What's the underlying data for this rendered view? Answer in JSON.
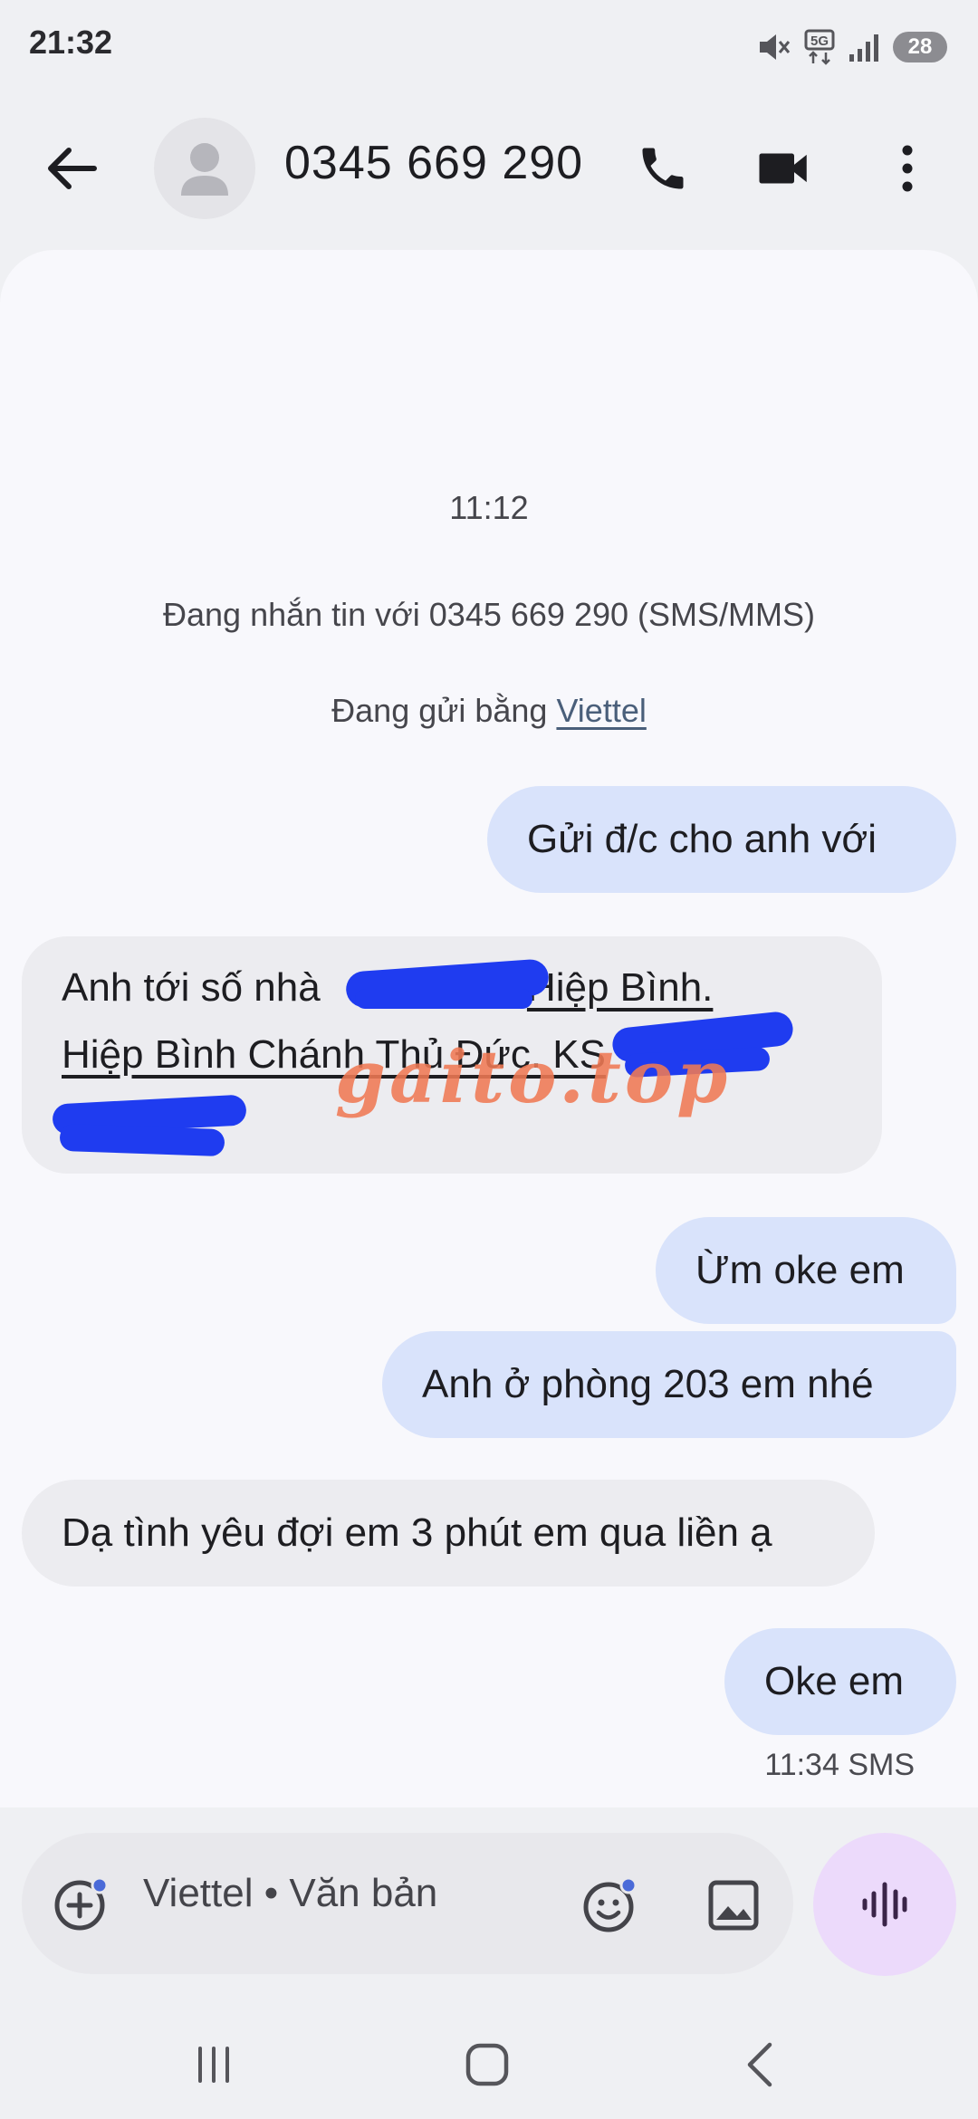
{
  "status_bar": {
    "time": "21:32",
    "battery": "28"
  },
  "header": {
    "contact": "0345 669 290"
  },
  "conversation": {
    "timestamp": "11:12",
    "info_line": "Đang nhắn tin với 0345 669 290 (SMS/MMS)",
    "sending_prefix": "Đang gửi bằng ",
    "carrier": "Viettel",
    "messages": [
      {
        "dir": "out",
        "text": "Gửi đ/c cho anh với"
      },
      {
        "dir": "in",
        "line1_prefix": "Anh tới số nhà ",
        "line1_link": "Hiệp Bình.",
        "line2": "Hiệp Bình Chánh Thủ Đức. KS"
      },
      {
        "dir": "out",
        "text": "Ừm oke em"
      },
      {
        "dir": "out",
        "text": "Anh ở phòng 203 em nhé"
      },
      {
        "dir": "in",
        "text": "Dạ tình yêu đợi em 3 phút em qua liền ạ"
      },
      {
        "dir": "out",
        "text": "Oke em"
      }
    ],
    "last_meta": "11:34 SMS"
  },
  "watermark": "gaito.top",
  "composer": {
    "placeholder": "Viettel • Văn bản"
  },
  "colors": {
    "outgoing": "#d9e3fb",
    "incoming": "#ececf0",
    "voice_button": "#ecdafb",
    "redaction": "#1f3cf0"
  }
}
